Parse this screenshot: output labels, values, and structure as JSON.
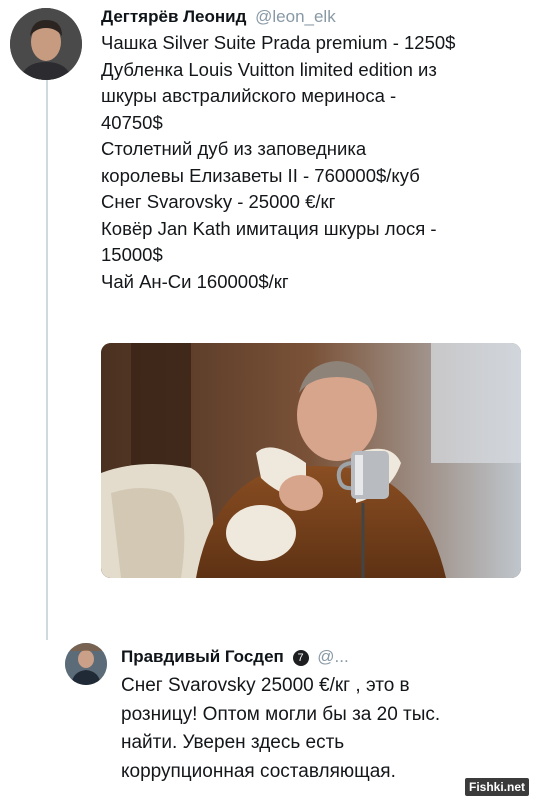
{
  "tweet_main": {
    "display_name": "Дегтярёв Леонид",
    "handle": "@leon_elk",
    "lines": [
      "Чашка Silver Suite Prada premium - 1250$",
      "Дубленка Louis Vuitton limited edition из",
      "шкуры австралийского мериноса -",
      "40750$",
      "Столетний дуб из заповедника",
      "королевы Елизаветы II - 760000$/куб",
      "Снег Svarovsky - 25000 €/кг",
      "Ковёр Jan Kath имитация шкуры лося -",
      "15000$",
      "Чай Ан-Си 160000$/кг"
    ]
  },
  "tweet_reply": {
    "display_name": "Правдивый Госдеп",
    "verified_badge": "7",
    "handle": "@...",
    "lines": [
      "Снег Svarovsky 25000 €/кг , это в",
      "розницу! Оптом могли бы за 20 тыс.",
      "найти. Уверен здесь есть",
      "коррупционная составляющая."
    ]
  },
  "watermark": "Fishki.net",
  "colors": {
    "handle": "#8899a6",
    "thread_line": "#cfd9de",
    "text": "#14171a"
  },
  "icons": [
    "avatar-photo",
    "verified-badge-icon",
    "tweet-photo"
  ]
}
